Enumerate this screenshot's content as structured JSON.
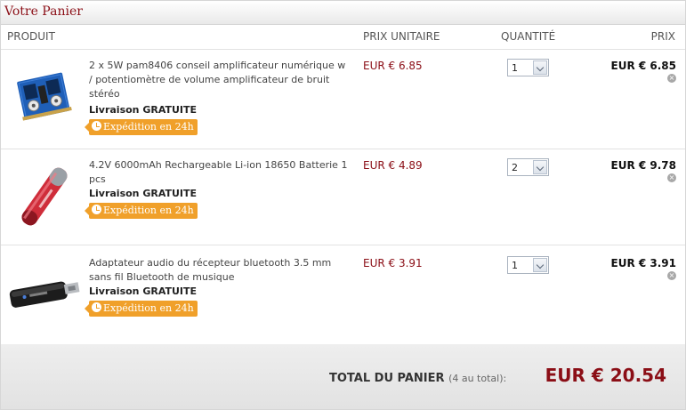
{
  "cart": {
    "title": "Votre Panier",
    "headers": {
      "product": "PRODUIT",
      "unit_price": "PRIX UNITAIRE",
      "quantity": "QUANTITÉ",
      "price": "PRIX"
    },
    "items": [
      {
        "name": "2 x 5W pam8406 conseil amplificateur numérique w / potentiomètre de volume amplificateur de bruit stéréo",
        "shipping": "Livraison GRATUITE",
        "badge": "Expédition en 24h",
        "unit_price": "EUR € 6.85",
        "quantity": "1",
        "price": "EUR € 6.85",
        "image": "amplifier-board"
      },
      {
        "name": "4.2V 6000mAh Rechargeable Li-ion 18650 Batterie 1 pcs",
        "shipping": "Livraison GRATUITE",
        "badge": "Expédition en 24h",
        "unit_price": "EUR € 4.89",
        "quantity": "2",
        "price": "EUR € 9.78",
        "image": "battery-18650"
      },
      {
        "name": "Adaptateur audio du récepteur bluetooth 3.5 mm sans fil Bluetooth de musique",
        "shipping": "Livraison GRATUITE",
        "badge": "Expédition en 24h",
        "unit_price": "EUR € 3.91",
        "quantity": "1",
        "price": "EUR € 3.91",
        "image": "bluetooth-receiver"
      }
    ],
    "total": {
      "label": "TOTAL DU PANIER",
      "count": "(4 au total):",
      "value": "EUR € 20.54"
    },
    "colors": {
      "accent": "#8b0e16",
      "badge": "#f0a02a"
    }
  }
}
